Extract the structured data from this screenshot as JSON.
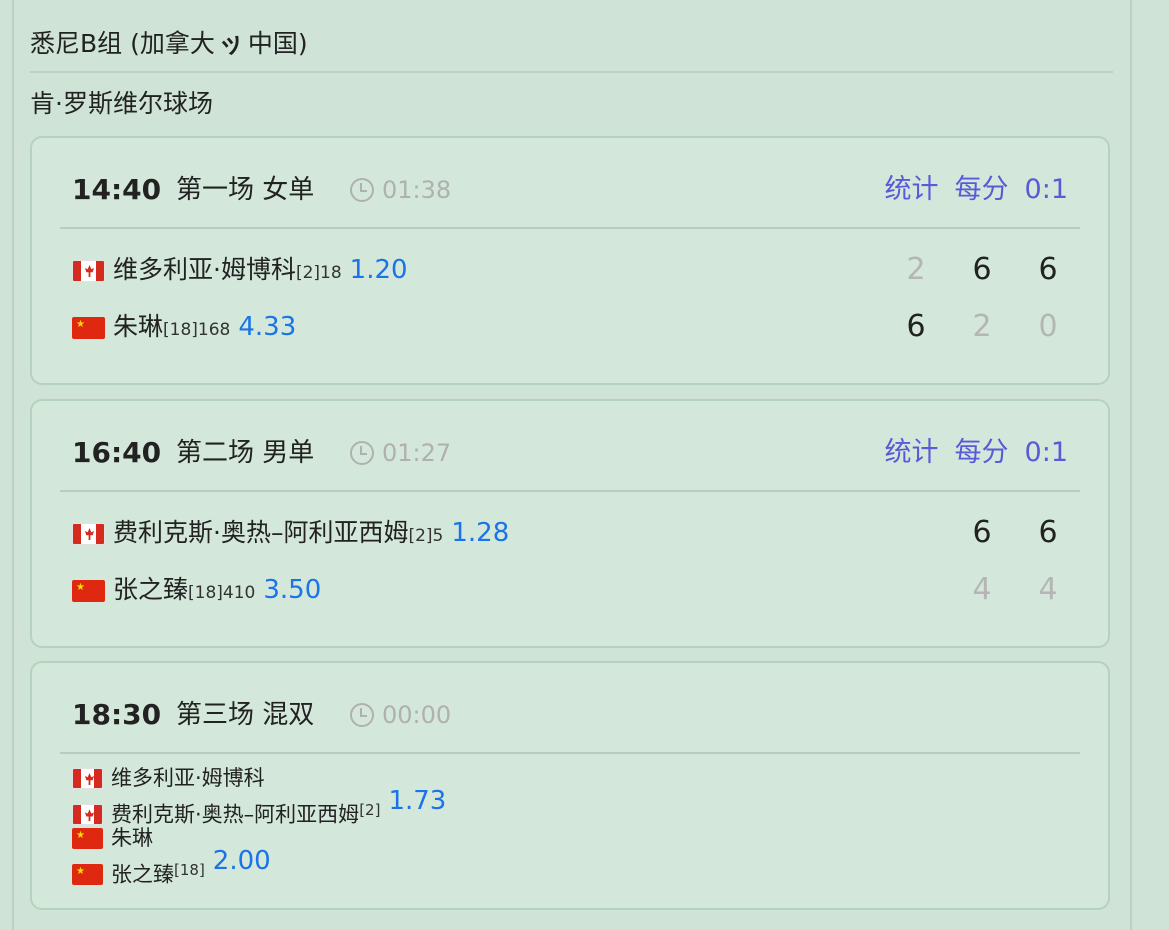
{
  "header": {
    "group_title": "悉尼B组 (加拿大",
    "group_sep": "ッ",
    "group_title_b": "中国)",
    "venue": "肯·罗斯维尔球场"
  },
  "matches": [
    {
      "time": "14:40",
      "name": "第一场 女单",
      "duration": "01:38",
      "links": {
        "stats": "统计",
        "points": "每分",
        "score": "0:1"
      },
      "players": [
        {
          "country": "CA",
          "name": "维多利亚·姆博科",
          "seed": "[2]18",
          "odds": "1.20",
          "sets": [
            "2",
            "6",
            "6"
          ]
        },
        {
          "country": "CN",
          "name": "朱琳",
          "seed": "[18]168",
          "odds": "4.33",
          "sets": [
            "6",
            "2",
            "0"
          ]
        }
      ]
    },
    {
      "time": "16:40",
      "name": "第二场 男单",
      "duration": "01:27",
      "links": {
        "stats": "统计",
        "points": "每分",
        "score": "0:1"
      },
      "players": [
        {
          "country": "CA",
          "name": "费利克斯·奥热–阿利亚西姆",
          "seed": "[2]5",
          "odds": "1.28",
          "sets": [
            "6",
            "6"
          ]
        },
        {
          "country": "CN",
          "name": "张之臻",
          "seed": "[18]410",
          "odds": "3.50",
          "sets": [
            "4",
            "4"
          ]
        }
      ]
    },
    {
      "time": "18:30",
      "name": "第三场 混双",
      "duration": "00:00",
      "teams": [
        {
          "players": [
            {
              "country": "CA",
              "name": "维多利亚·姆博科"
            },
            {
              "country": "CA",
              "name": "费利克斯·奥热–阿利亚西姆"
            }
          ],
          "seed": "[2]",
          "odds": "1.73"
        },
        {
          "players": [
            {
              "country": "CN",
              "name": "朱琳"
            },
            {
              "country": "CN",
              "name": "张之臻"
            }
          ],
          "seed": "[18]",
          "odds": "2.00"
        }
      ]
    }
  ]
}
